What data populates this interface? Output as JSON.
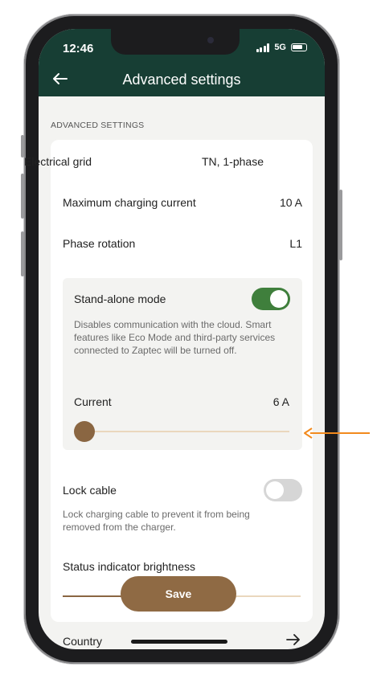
{
  "status_bar": {
    "time": "12:46",
    "network": "5G"
  },
  "header": {
    "title": "Advanced settings"
  },
  "section_label": "ADVANCED SETTINGS",
  "settings": {
    "electrical_grid": {
      "label": "Electrical grid",
      "value": "TN, 1-phase"
    },
    "max_current": {
      "label": "Maximum charging current",
      "value": "10 A"
    },
    "phase_rotation": {
      "label": "Phase rotation",
      "value": "L1"
    }
  },
  "standalone": {
    "label": "Stand-alone mode",
    "enabled": true,
    "description": "Disables communication with the cloud. Smart features like Eco Mode and third-party services connected to Zaptec will be turned off.",
    "current_label": "Current",
    "current_value": "6 A",
    "slider_level": 0
  },
  "lock_cable": {
    "label": "Lock cable",
    "enabled": false,
    "description": "Lock charging cable to prevent it from being removed from the charger."
  },
  "brightness": {
    "label": "Status indicator brightness",
    "slider_level": 0.3
  },
  "country": {
    "label": "Country"
  },
  "save_label": "Save",
  "colors": {
    "header_bg": "#173e34",
    "accent_brown": "#8f6a44",
    "toggle_on": "#3f7f3c",
    "toggle_off": "#d6d6d6",
    "pointer_arrow": "#f28a1d"
  }
}
